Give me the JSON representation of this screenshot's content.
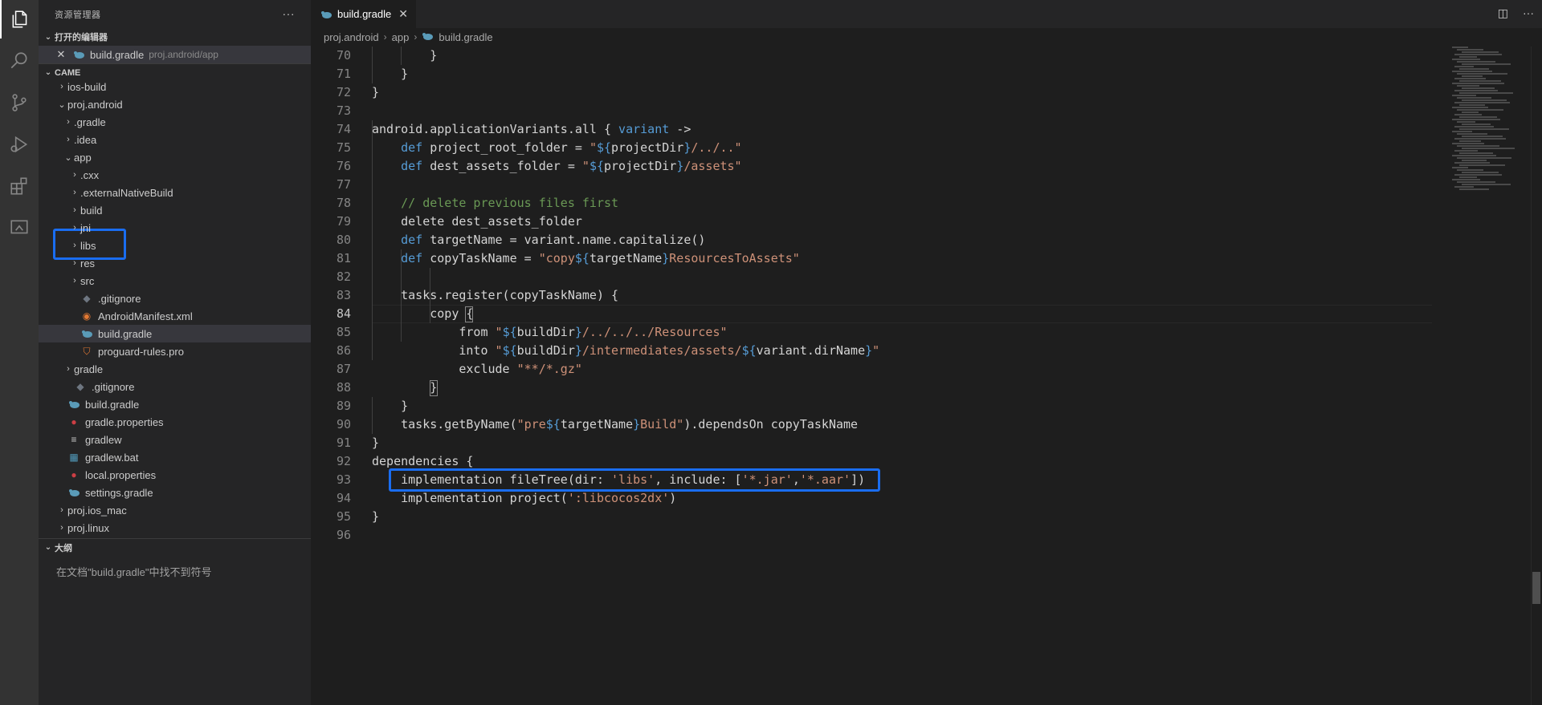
{
  "explorer": {
    "title": "资源管理器",
    "more": "···",
    "open_editors_label": "打开的编辑器",
    "open_editor": {
      "name": "build.gradle",
      "path": "proj.android/app"
    },
    "workspace_label": "CAME",
    "tree": [
      "ios-build",
      "proj.android",
      ".gradle",
      ".idea",
      "app",
      ".cxx",
      ".externalNativeBuild",
      "build",
      "jni",
      "libs",
      "res",
      "src",
      ".gitignore",
      "AndroidManifest.xml",
      "build.gradle",
      "proguard-rules.pro",
      "gradle",
      ".gitignore",
      "build.gradle",
      "gradle.properties",
      "gradlew",
      "gradlew.bat",
      "local.properties",
      "settings.gradle",
      "proj.ios_mac",
      "proj.linux"
    ],
    "outline_label": "大纲",
    "outline_empty": "在文档\"build.gradle\"中找不到符号"
  },
  "editor": {
    "tab_label": "build.gradle",
    "breadcrumb": [
      "proj.android",
      "app",
      "build.gradle"
    ],
    "line_numbers": [
      "70",
      "71",
      "72",
      "73",
      "74",
      "75",
      "76",
      "77",
      "78",
      "79",
      "80",
      "81",
      "82",
      "83",
      "84",
      "85",
      "86",
      "87",
      "88",
      "89",
      "90",
      "91",
      "92",
      "93",
      "94",
      "95",
      "96"
    ],
    "current_line": "84",
    "code": {
      "l70": "        }",
      "l71": "    }",
      "l72": "}",
      "l74_a": "android.applicationVariants.all { ",
      "l74_b": "variant",
      "l74_c": " ->",
      "l75_kw": "def",
      "l75_a": " project_root_folder = ",
      "l75_s1": "\"",
      "l75_i": "${",
      "l75_v": "projectDir",
      "l75_i2": "}",
      "l75_s2": "/../..\"",
      "l76_kw": "def",
      "l76_a": " dest_assets_folder = ",
      "l76_s1": "\"",
      "l76_i": "${",
      "l76_v": "projectDir",
      "l76_i2": "}",
      "l76_s2": "/assets\"",
      "l78": "// delete previous files first",
      "l79": "delete dest_assets_folder",
      "l80_kw": "def",
      "l80_a": " targetName = variant.name.capitalize()",
      "l81_kw": "def",
      "l81_a": " copyTaskName = ",
      "l81_s1": "\"copy",
      "l81_i": "${",
      "l81_v": "targetName",
      "l81_i2": "}",
      "l81_s2": "ResourcesToAssets\"",
      "l83": "tasks.register(copyTaskName) {",
      "l84": "copy {",
      "l85_a": "from ",
      "l85_s1": "\"",
      "l85_i": "${",
      "l85_v": "buildDir",
      "l85_i2": "}",
      "l85_s2": "/../../../Resources\"",
      "l86_a": "into ",
      "l86_s1": "\"",
      "l86_i": "${",
      "l86_v": "buildDir",
      "l86_i2": "}",
      "l86_s2": "/intermediates/assets/",
      "l86_i3": "${",
      "l86_v2": "variant.dirName",
      "l86_i4": "}",
      "l86_s3": "\"",
      "l87_a": "exclude ",
      "l87_s": "\"**/*.gz\"",
      "l88": "}",
      "l89": "}",
      "l90_a": "tasks.getByName(",
      "l90_s1": "\"pre",
      "l90_i": "${",
      "l90_v": "targetName",
      "l90_i2": "}",
      "l90_s2": "Build\"",
      "l90_b": ").dependsOn copyTaskName",
      "l91": "}",
      "l92": "dependencies {",
      "l93_a": "implementation fileTree(dir: ",
      "l93_s1": "'libs'",
      "l93_b": ", include: [",
      "l93_s2": "'*.jar'",
      "l93_c": ",",
      "l93_s3": "'*.aar'",
      "l93_d": "])",
      "l94_a": "implementation project(",
      "l94_s": "':libcocos2dx'",
      "l94_b": ")",
      "l95": "}"
    }
  },
  "colors": {
    "highlight": "#1a6df0",
    "keyword": "#569cd6",
    "string": "#ce9178",
    "comment": "#6a9955"
  }
}
